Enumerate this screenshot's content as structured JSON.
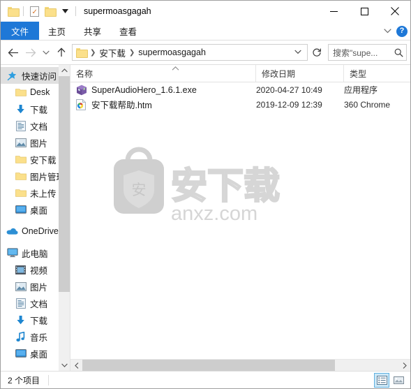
{
  "window": {
    "title": "supermoasgagah",
    "quick_access_toolbar": [
      {
        "name": "folder-icon",
        "label": "属性"
      },
      {
        "name": "properties-icon",
        "label": "属性"
      },
      {
        "name": "new-folder-icon",
        "label": "新建文件夹"
      },
      {
        "name": "customize-dropdown-icon",
        "label": "自定义快速访问工具栏"
      }
    ],
    "controls": {
      "minimize": "最小化",
      "maximize": "最大化",
      "close": "关闭"
    }
  },
  "ribbon": {
    "tabs": [
      {
        "label": "文件",
        "active": true
      },
      {
        "label": "主页",
        "active": false
      },
      {
        "label": "共享",
        "active": false
      },
      {
        "label": "查看",
        "active": false
      }
    ],
    "collapse_icon": "chevron-down-icon",
    "help_label": "?"
  },
  "nav": {
    "back": "←",
    "forward": "→",
    "recent": "⌄",
    "up": "↑",
    "breadcrumbs": [
      "安下载",
      "supermoasgagah"
    ],
    "breadcrumb_chevron": "⌄",
    "refresh": "↻"
  },
  "search": {
    "placeholder": "搜索\"supe...",
    "icon": "search-icon"
  },
  "sidebar": {
    "items": [
      {
        "label": "快速访问",
        "icon": "star-pin-icon",
        "selected": true,
        "indent": false,
        "pinned": false,
        "gap": false
      },
      {
        "label": "Desk",
        "icon": "folder-icon",
        "selected": false,
        "indent": true,
        "pinned": true,
        "gap": false
      },
      {
        "label": "下载",
        "icon": "download-icon",
        "selected": false,
        "indent": true,
        "pinned": true,
        "gap": false
      },
      {
        "label": "文档",
        "icon": "document-icon",
        "selected": false,
        "indent": true,
        "pinned": true,
        "gap": false
      },
      {
        "label": "图片",
        "icon": "pictures-icon",
        "selected": false,
        "indent": true,
        "pinned": true,
        "gap": false
      },
      {
        "label": "安下载",
        "icon": "folder-icon",
        "selected": false,
        "indent": true,
        "pinned": false,
        "gap": false
      },
      {
        "label": "图片管理",
        "icon": "folder-icon",
        "selected": false,
        "indent": true,
        "pinned": false,
        "gap": false
      },
      {
        "label": "未上传",
        "icon": "folder-icon",
        "selected": false,
        "indent": true,
        "pinned": false,
        "gap": false
      },
      {
        "label": "桌面",
        "icon": "desktop-icon",
        "selected": false,
        "indent": true,
        "pinned": false,
        "gap": false
      },
      {
        "label": "OneDrive",
        "icon": "onedrive-cloud-icon",
        "selected": false,
        "indent": false,
        "pinned": false,
        "gap": true
      },
      {
        "label": "此电脑",
        "icon": "this-pc-icon",
        "selected": false,
        "indent": false,
        "pinned": false,
        "gap": true
      },
      {
        "label": "视频",
        "icon": "videos-icon",
        "selected": false,
        "indent": true,
        "pinned": false,
        "gap": false
      },
      {
        "label": "图片",
        "icon": "pictures-icon",
        "selected": false,
        "indent": true,
        "pinned": false,
        "gap": false
      },
      {
        "label": "文档",
        "icon": "document-icon",
        "selected": false,
        "indent": true,
        "pinned": false,
        "gap": false
      },
      {
        "label": "下载",
        "icon": "download-icon",
        "selected": false,
        "indent": true,
        "pinned": false,
        "gap": false
      },
      {
        "label": "音乐",
        "icon": "music-icon",
        "selected": false,
        "indent": true,
        "pinned": false,
        "gap": false
      },
      {
        "label": "桌面",
        "icon": "desktop-icon",
        "selected": false,
        "indent": true,
        "pinned": false,
        "gap": false
      }
    ]
  },
  "filelist": {
    "columns": [
      {
        "key": "name",
        "label": "名称",
        "sorted": "asc"
      },
      {
        "key": "date",
        "label": "修改日期",
        "sorted": null
      },
      {
        "key": "type",
        "label": "类型",
        "sorted": null
      }
    ],
    "rows": [
      {
        "name": "SuperAudioHero_1.6.1.exe",
        "date": "2020-04-27 10:49",
        "type": "应用程序",
        "icon": "exe-cube-icon"
      },
      {
        "name": "安下载帮助.htm",
        "date": "2019-12-09 12:39",
        "type": "360 Chrome",
        "icon": "html-page-icon"
      }
    ]
  },
  "watermark": {
    "brand_text": "安下载",
    "domain_text": "anxz.com",
    "logo_char": "安",
    "color": "#d8d8d8"
  },
  "statusbar": {
    "item_count_text": "2 个项目",
    "view_buttons": [
      {
        "name": "details-view-button",
        "label": "详细信息",
        "active": true
      },
      {
        "name": "large-icons-view-button",
        "label": "大图标",
        "active": false
      }
    ]
  }
}
